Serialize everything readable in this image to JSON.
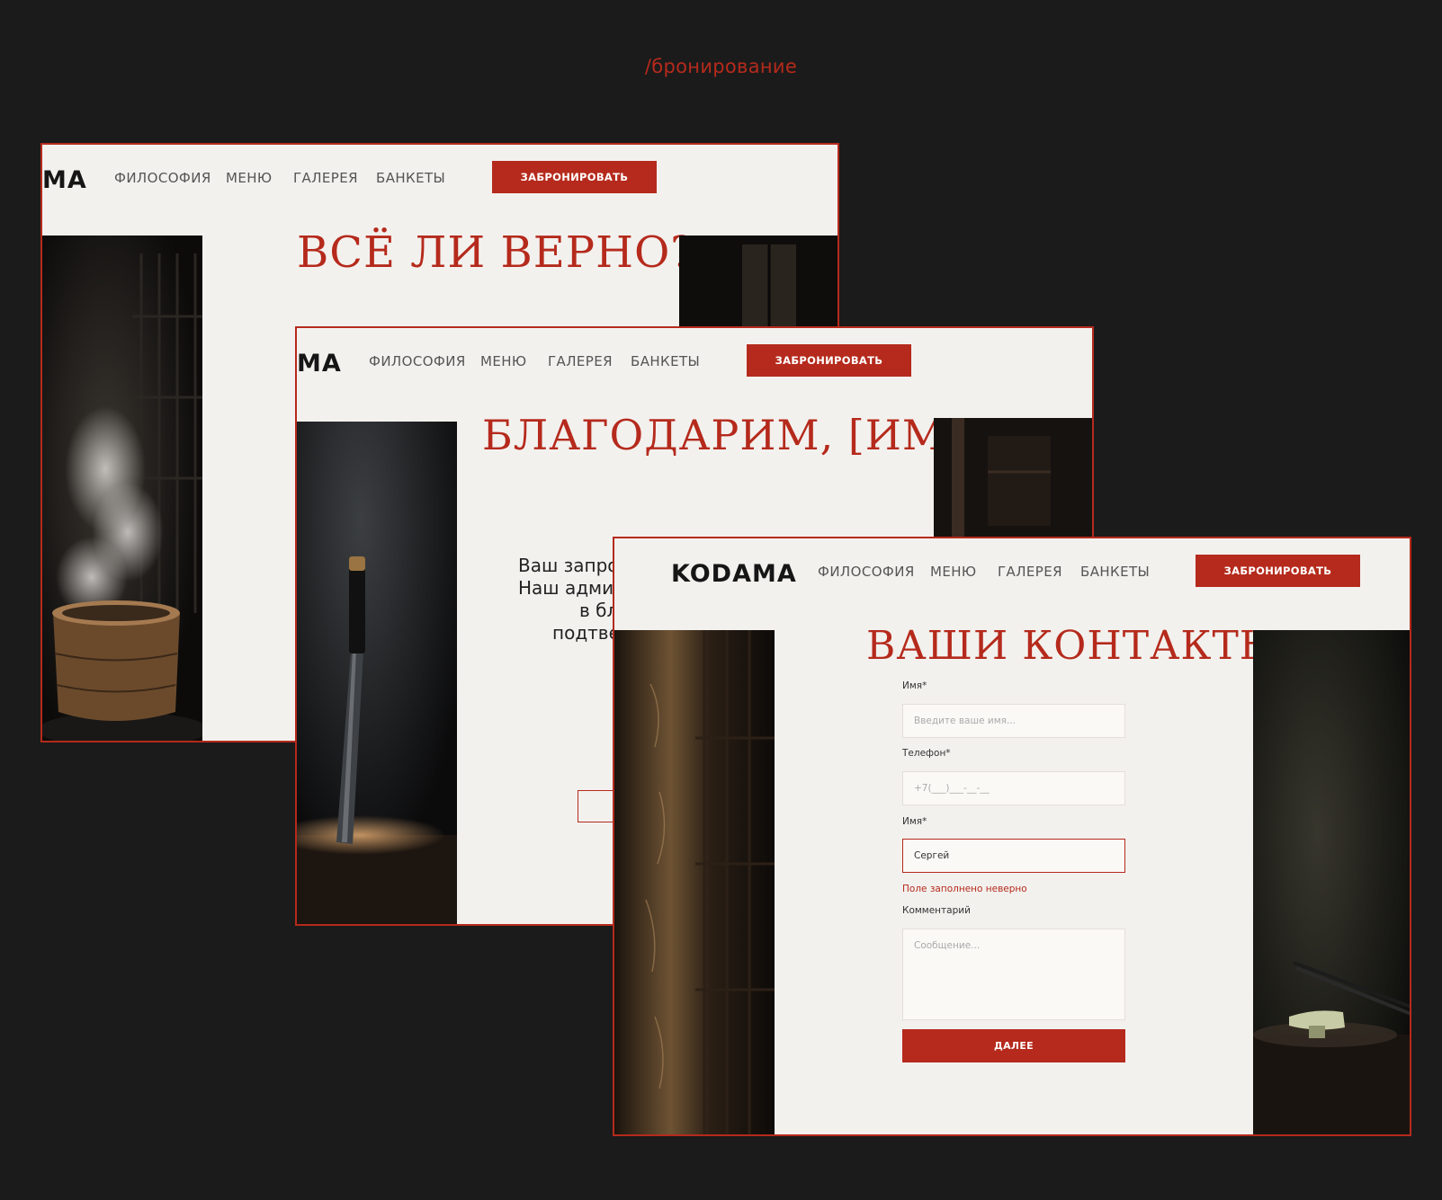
{
  "section_title": "/бронирование",
  "nav": {
    "logo": "KODAMA",
    "logo_partial": "MA",
    "items": [
      "ФИЛОСОФИЯ",
      "МЕНЮ",
      "ГАЛЕРЕЯ",
      "БАНКЕТЫ"
    ],
    "book_button": "ЗАБРОНИРОВАТЬ"
  },
  "screen_confirm": {
    "heading": "ВСЁ ЛИ ВЕРНО?"
  },
  "screen_thanks": {
    "heading": "БЛАГОДАРИМ, [ИМЯ]!",
    "message_lines": [
      "Ваш запро",
      "Наш адми",
      "в бл",
      "подтве"
    ]
  },
  "screen_contacts": {
    "heading": "ВАШИ КОНТАКТЫ",
    "fields": {
      "name_label": "Имя*",
      "name_placeholder": "Введите ваше имя...",
      "phone_label": "Телефон*",
      "phone_placeholder": "+7(___)___-__-__",
      "name2_label": "Имя*",
      "name2_value": "Сергей",
      "error_text": "Поле заполнено неверно",
      "comment_label": "Комментарий",
      "comment_placeholder": "Сообщение..."
    },
    "next_button": "ДАЛЕЕ"
  },
  "colors": {
    "accent": "#b52a1c",
    "background": "#1b1b1b",
    "page": "#f3f1ee"
  }
}
